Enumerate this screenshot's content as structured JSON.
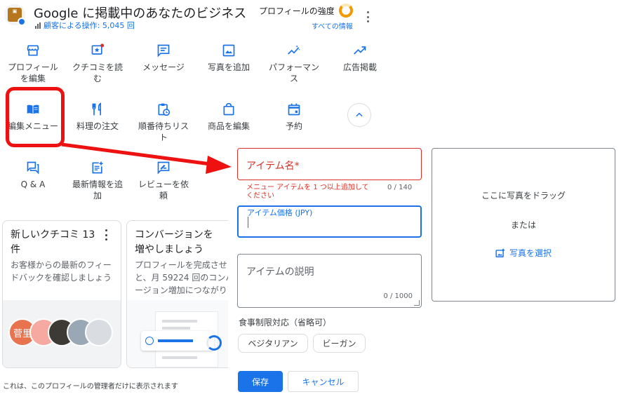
{
  "header": {
    "title": "Google に掲載中のあなたのビジネス",
    "customer_actions": "顧客による操作: 5,045 回",
    "strength_label": "プロフィールの強度",
    "all_info": "すべての情報"
  },
  "actions_row1": [
    {
      "label": "プロフィール\nを編集",
      "icon": "store-icon"
    },
    {
      "label": "クチコミを読\nむ",
      "icon": "review-icon"
    },
    {
      "label": "メッセージ",
      "icon": "message-icon"
    },
    {
      "label": "写真を追加",
      "icon": "photo-icon"
    },
    {
      "label": "パフォーマン\nス",
      "icon": "performance-icon"
    },
    {
      "label": "広告掲載",
      "icon": "trending-icon"
    }
  ],
  "actions_row2": [
    {
      "label": "編集メニュー",
      "icon": "menu-book-icon"
    },
    {
      "label": "料理の注文",
      "icon": "restaurant-icon"
    },
    {
      "label": "順番待ちリス\nト",
      "icon": "waitlist-icon"
    },
    {
      "label": "商品を編集",
      "icon": "shopping-bag-icon"
    },
    {
      "label": "予約",
      "icon": "calendar-icon"
    }
  ],
  "actions_row3": [
    {
      "label": "Q & A",
      "icon": "qa-icon"
    },
    {
      "label": "最新情報を追\n加",
      "icon": "post-add-icon"
    },
    {
      "label": "レビューを依\n頼",
      "icon": "rate-review-icon"
    }
  ],
  "cards": {
    "reviews": {
      "title": "新しいクチコミ 13\n件",
      "desc": "お客様からの最新のフィー\nドバックを確認しましょう",
      "avatar_text": "菅里"
    },
    "conversion": {
      "title": "コンバージョンを\n増やしましょう",
      "desc": "プロフィールを完成させ\nと、月 59224 回のコンバ\nージョン増加につながり"
    }
  },
  "footer_note": "これは、このプロフィールの管理者だけに表示されます",
  "form": {
    "item_name_placeholder": "アイテム名*",
    "item_name_error": "メニュー アイテムを 1 つ以上追加して\nください",
    "item_name_count": "0 / 140",
    "price_label": "アイテム価格 (JPY)",
    "desc_placeholder": "アイテムの説明",
    "desc_count": "0 / 1000",
    "diet_label": "食事制限対応（省略可）",
    "chips": [
      "ベジタリアン",
      "ビーガン"
    ],
    "save": "保存",
    "cancel": "キャンセル"
  },
  "photo": {
    "drag_text": "ここに写真をドラッグ",
    "or_text": "または",
    "select_text": "写真を選択"
  },
  "colors": {
    "accent": "#1a73e8",
    "error": "#d93025",
    "highlight": "#ee1111",
    "strength": "#f29900"
  }
}
